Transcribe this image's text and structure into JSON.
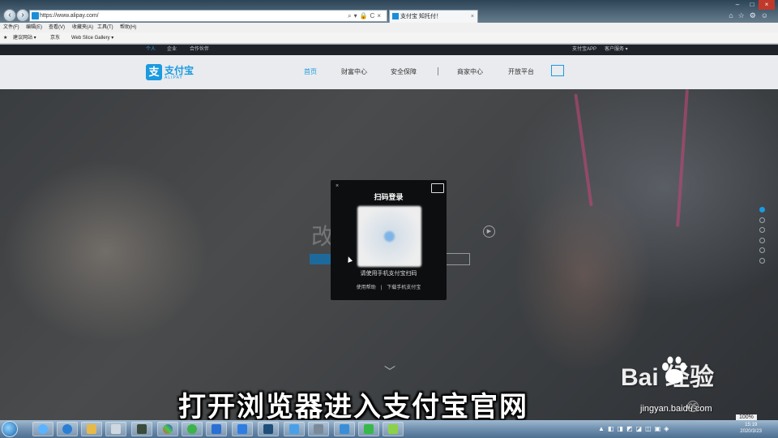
{
  "browser": {
    "url": "https://www.alipay.com/",
    "tab_title": "支付宝 知托付！",
    "back_icon": "back-arrow-icon",
    "forward_icon": "forward-arrow-icon",
    "menu": [
      "文件(F)",
      "编辑(E)",
      "查看(V)",
      "收藏夹(A)",
      "工具(T)",
      "帮助(H)"
    ],
    "favorites": [
      "建议网站 ▾",
      "京东",
      "Web Slice Gallery ▾"
    ],
    "zoom": "100%"
  },
  "site": {
    "top_tabs": [
      "个人",
      "企业",
      "合作伙伴"
    ],
    "top_right": [
      "支付宝APP",
      "客户服务 ▾"
    ],
    "logo_text": "支付宝",
    "logo_sub": "ALIPAY",
    "logo_glyph": "支",
    "nav": [
      "首页",
      "财富中心",
      "安全保障",
      "商家中心",
      "开放平台"
    ],
    "hero_slogan": "改变  而来",
    "accent": "#1b9ae0"
  },
  "qr_login": {
    "title": "扫码登录",
    "hint": "请使用手机支付宝扫码",
    "links": [
      "使用帮助",
      "下载手机支付宝"
    ],
    "close": "×"
  },
  "overlay": {
    "caption": "打开浏览器进入支付宝官网",
    "watermark": "Bai  经验",
    "watermark_sub": "jingyan.baidu.com",
    "counter": "05"
  },
  "taskbar": {
    "time": "15:19",
    "date": "2020/3/23"
  }
}
